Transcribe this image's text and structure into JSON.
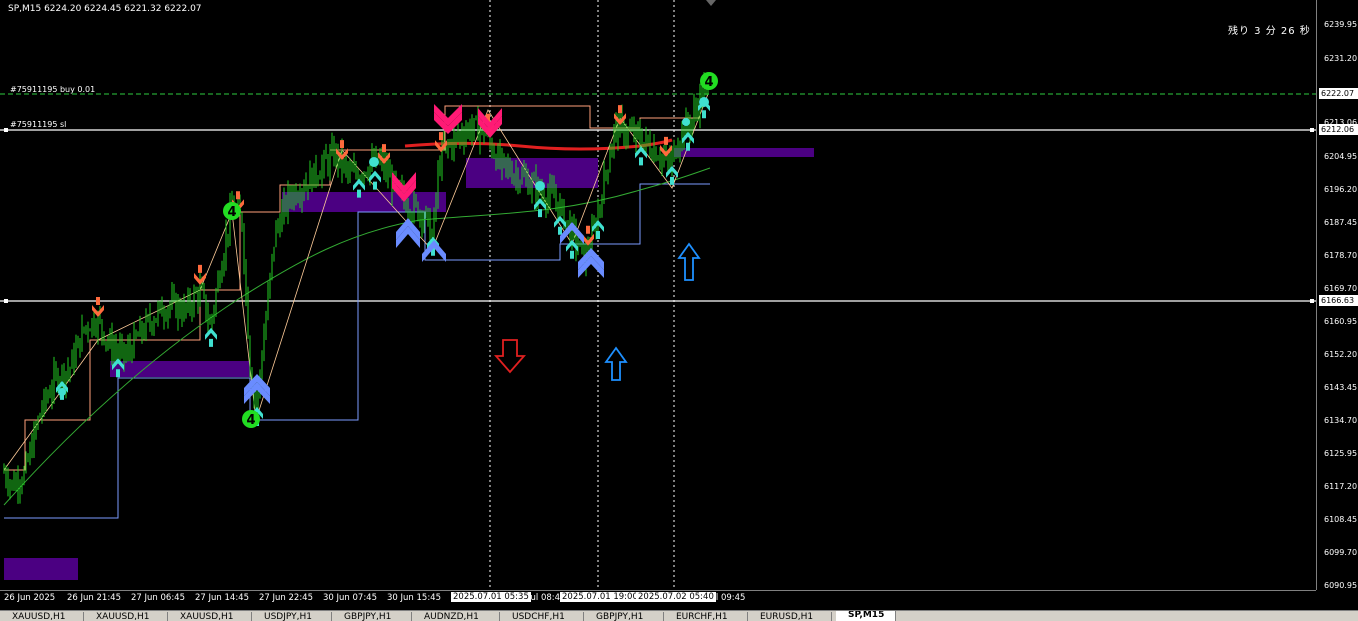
{
  "symbol_info": "SP,M15  6224.20 6224.45 6221.32 6222.07",
  "countdown": "残り 3 分 26 秒",
  "orders": {
    "buy_label": "#75911195 buy 0.01",
    "sl_label": "#75911195 sl"
  },
  "price_axis": {
    "labels": [
      "6239.95",
      "6231.20",
      "6213.06",
      "6204.95",
      "6196.20",
      "6187.45",
      "6178.70",
      "6169.70",
      "6160.95",
      "6152.20",
      "6143.45",
      "6134.70",
      "6125.95",
      "6117.20",
      "6108.45",
      "6099.70",
      "6090.95"
    ],
    "current_price": "6222.07",
    "sl_price": "6212.06",
    "line_price": "6166.63"
  },
  "time_axis": {
    "labels": [
      "26 Jun 2025",
      "26 Jun 21:45",
      "27 Jun 06:45",
      "27 Jun 14:45",
      "27 Jun 22:45",
      "30 Jun 07:45",
      "30 Jun 15:45",
      "Jul 08:45",
      "Jul 09:45"
    ],
    "badges": [
      "2025.07.01 05:35",
      "2025.07.01 19:00",
      "2025.07.02 05:40"
    ]
  },
  "tabs": [
    "XAUUSD,H1",
    "XAUUSD,H1",
    "XAUUSD,H1",
    "USDJPY,H1",
    "GBPJPY,H1",
    "AUDNZD,H1",
    "USDCHF,H1",
    "GBPJPY,H1",
    "EURCHF,H1",
    "EURUSD,H1",
    "SP,M15"
  ],
  "active_tab_index": 10,
  "colors": {
    "background": "#000000",
    "candle": "#22cc22",
    "sell_arrow": "#ff6a3d",
    "buy_arrow": "#40e0d0",
    "big_sell": "#ff1a75",
    "big_buy": "#6a8cff",
    "zone": "#4b0082",
    "ma_long": "#33aa33",
    "ma_red": "#e02020",
    "zigzag": "#ffa07a",
    "outline_up": "#1e90ff",
    "outline_down": "#e02020",
    "badge_green": "#22dd22"
  },
  "chart_data": {
    "type": "candlestick",
    "x_range": [
      "26 Jun 2025",
      "Jul 09:45"
    ],
    "ylim": [
      6090.95,
      6239.95
    ],
    "close_path": [
      [
        0,
        6123
      ],
      [
        12,
        6118
      ],
      [
        25,
        6121
      ],
      [
        40,
        6137
      ],
      [
        55,
        6146
      ],
      [
        70,
        6149
      ],
      [
        85,
        6160
      ],
      [
        97,
        6162
      ],
      [
        110,
        6155
      ],
      [
        125,
        6152
      ],
      [
        140,
        6158
      ],
      [
        155,
        6163
      ],
      [
        170,
        6166
      ],
      [
        185,
        6164
      ],
      [
        200,
        6170
      ],
      [
        210,
        6160
      ],
      [
        222,
        6178
      ],
      [
        232,
        6192
      ],
      [
        242,
        6188
      ],
      [
        250,
        6150
      ],
      [
        256,
        6138
      ],
      [
        265,
        6160
      ],
      [
        275,
        6185
      ],
      [
        290,
        6195
      ],
      [
        305,
        6198
      ],
      [
        320,
        6202
      ],
      [
        335,
        6206
      ],
      [
        350,
        6200
      ],
      [
        365,
        6202
      ],
      [
        380,
        6204
      ],
      [
        395,
        6197
      ],
      [
        410,
        6192
      ],
      [
        425,
        6190
      ],
      [
        432,
        6183
      ],
      [
        440,
        6205
      ],
      [
        455,
        6210
      ],
      [
        470,
        6213
      ],
      [
        485,
        6212
      ],
      [
        500,
        6203
      ],
      [
        520,
        6200
      ],
      [
        540,
        6196
      ],
      [
        555,
        6194
      ],
      [
        570,
        6186
      ],
      [
        585,
        6178
      ],
      [
        595,
        6186
      ],
      [
        605,
        6200
      ],
      [
        615,
        6213
      ],
      [
        625,
        6212
      ],
      [
        640,
        6210
      ],
      [
        655,
        6207
      ],
      [
        670,
        6203
      ],
      [
        680,
        6211
      ],
      [
        692,
        6215
      ],
      [
        702,
        6222
      ],
      [
        708,
        6223
      ]
    ],
    "sell_arrows_x": [
      98,
      200,
      238,
      342,
      384,
      441,
      488,
      588,
      620,
      666
    ],
    "buy_arrows_x": [
      62,
      118,
      211,
      257,
      359,
      375,
      433,
      540,
      560,
      572,
      598,
      641,
      672,
      688,
      704
    ],
    "zigzag_labels": [
      "4",
      "4",
      "4"
    ]
  }
}
